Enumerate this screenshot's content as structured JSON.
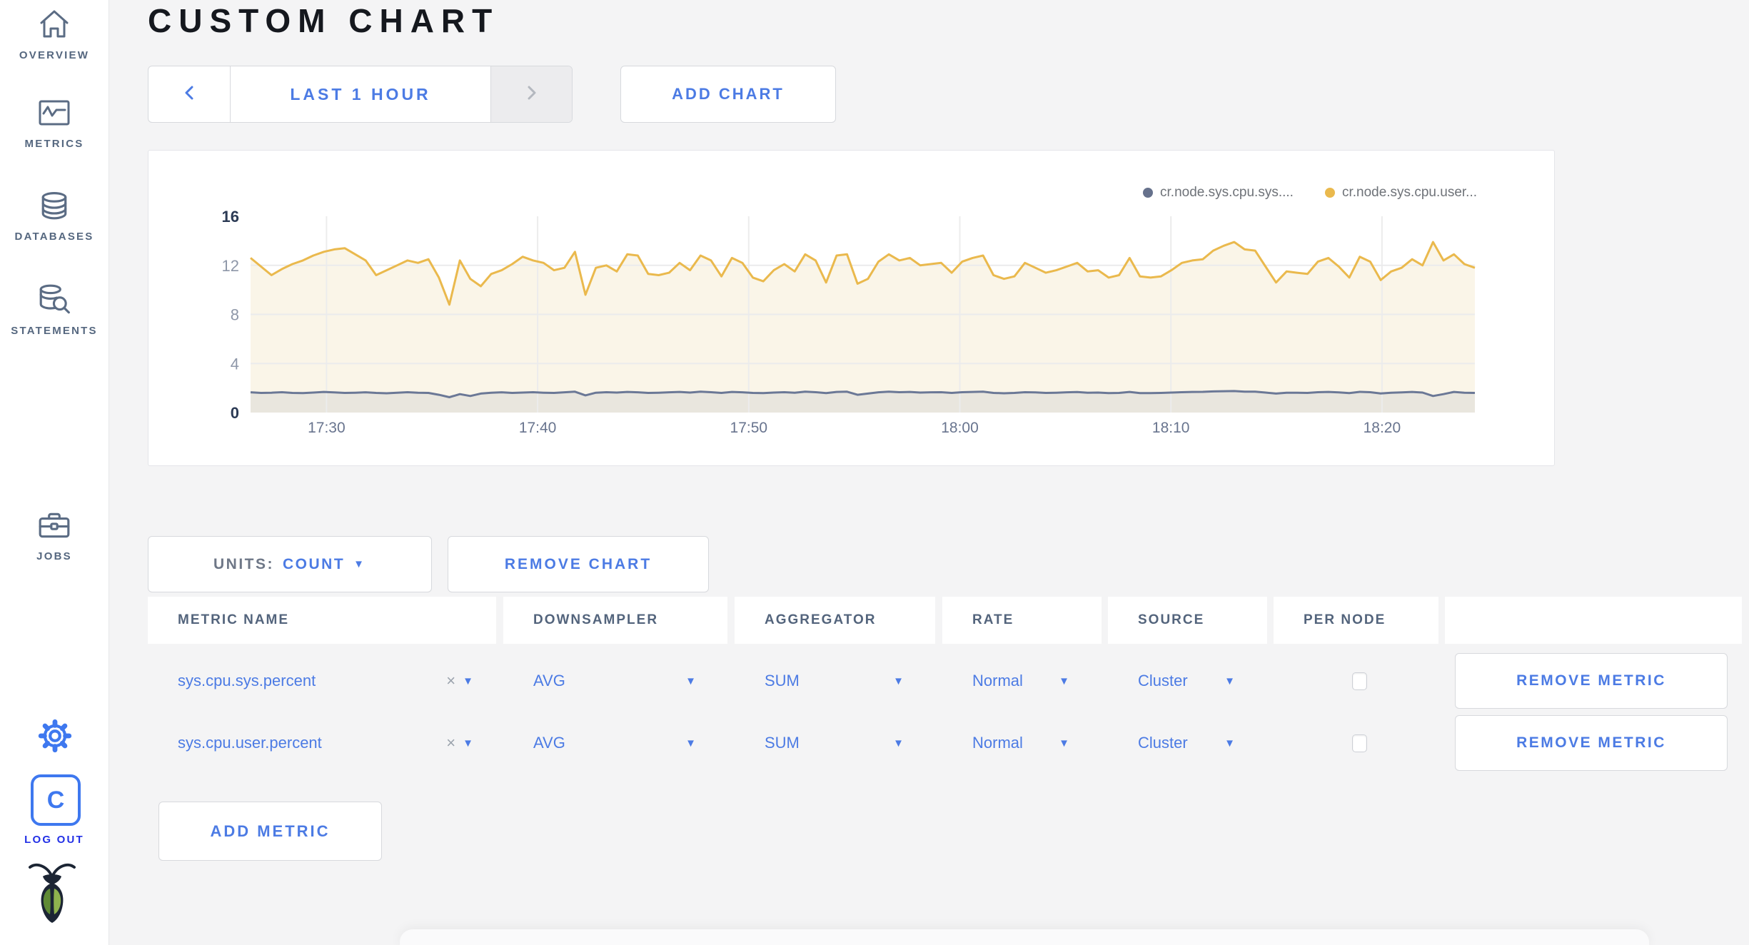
{
  "page": {
    "title": "CUSTOM CHART"
  },
  "colors": {
    "accent_blue": "#4c7be4",
    "logout_blue": "#2230e6",
    "sidebar_slate": "#55677f",
    "series_gray": "#66718c",
    "series_yellow": "#eab94d"
  },
  "sidebar": {
    "items": [
      {
        "label": "OVERVIEW",
        "icon": "home-icon"
      },
      {
        "label": "METRICS",
        "icon": "metrics-icon"
      },
      {
        "label": "DATABASES",
        "icon": "database-icon"
      },
      {
        "label": "STATEMENTS",
        "icon": "statements-icon"
      },
      {
        "label": "JOBS",
        "icon": "jobs-icon"
      }
    ],
    "logout_label": "LOG OUT"
  },
  "toolbar": {
    "time_range_label": "LAST 1 HOUR",
    "add_chart_label": "ADD CHART"
  },
  "chart_card": {
    "legend": [
      {
        "label": "cr.node.sys.cpu.sys....",
        "color": "#66718c"
      },
      {
        "label": "cr.node.sys.cpu.user...",
        "color": "#eab94d"
      }
    ]
  },
  "chart_data": {
    "type": "area",
    "title": "",
    "xlabel": "",
    "ylabel": "",
    "ylim": [
      0,
      16
    ],
    "x_domain_minutes": 58,
    "yticks": [
      {
        "v": 16,
        "strong": true,
        "grid": false
      },
      {
        "v": 12,
        "strong": false,
        "grid": true
      },
      {
        "v": 8,
        "strong": false,
        "grid": true
      },
      {
        "v": 4,
        "strong": false,
        "grid": true
      },
      {
        "v": 0,
        "strong": true,
        "grid": false
      }
    ],
    "xticks": [
      {
        "label": "17:30",
        "min": 3.6
      },
      {
        "label": "17:40",
        "min": 13.6
      },
      {
        "label": "17:50",
        "min": 23.6
      },
      {
        "label": "18:00",
        "min": 33.6
      },
      {
        "label": "18:10",
        "min": 43.6
      },
      {
        "label": "18:20",
        "min": 53.6
      }
    ],
    "series": [
      {
        "name": "cr.node.sys.cpu.sys....",
        "color": "#6b7896",
        "fill": "#e9e6de",
        "values": [
          1.65,
          1.6,
          1.62,
          1.66,
          1.6,
          1.58,
          1.63,
          1.68,
          1.64,
          1.6,
          1.62,
          1.65,
          1.6,
          1.57,
          1.62,
          1.66,
          1.62,
          1.6,
          1.45,
          1.25,
          1.5,
          1.35,
          1.55,
          1.62,
          1.65,
          1.6,
          1.63,
          1.66,
          1.62,
          1.6,
          1.65,
          1.7,
          1.4,
          1.62,
          1.66,
          1.63,
          1.68,
          1.65,
          1.6,
          1.62,
          1.65,
          1.68,
          1.63,
          1.7,
          1.66,
          1.6,
          1.68,
          1.65,
          1.6,
          1.58,
          1.63,
          1.66,
          1.62,
          1.7,
          1.66,
          1.58,
          1.68,
          1.7,
          1.45,
          1.55,
          1.65,
          1.7,
          1.66,
          1.68,
          1.63,
          1.65,
          1.66,
          1.6,
          1.66,
          1.68,
          1.7,
          1.6,
          1.57,
          1.6,
          1.66,
          1.64,
          1.6,
          1.62,
          1.65,
          1.67,
          1.62,
          1.63,
          1.58,
          1.6,
          1.68,
          1.59,
          1.58,
          1.6,
          1.63,
          1.66,
          1.68,
          1.69,
          1.72,
          1.74,
          1.75,
          1.7,
          1.7,
          1.63,
          1.55,
          1.62,
          1.61,
          1.6,
          1.66,
          1.68,
          1.64,
          1.58,
          1.69,
          1.66,
          1.56,
          1.62,
          1.64,
          1.68,
          1.63,
          1.35,
          1.5,
          1.68,
          1.62,
          1.6
        ]
      },
      {
        "name": "cr.node.sys.cpu.user...",
        "color": "#eab94d",
        "fill": "#faf5e8",
        "values": [
          12.6,
          11.9,
          11.2,
          11.7,
          12.1,
          12.4,
          12.8,
          13.1,
          13.3,
          13.4,
          12.9,
          12.4,
          11.2,
          11.6,
          12.0,
          12.4,
          12.2,
          12.5,
          11.0,
          8.8,
          12.4,
          10.9,
          10.3,
          11.3,
          11.6,
          12.1,
          12.7,
          12.4,
          12.2,
          11.6,
          11.8,
          13.1,
          9.6,
          11.8,
          12.0,
          11.5,
          12.9,
          12.8,
          11.3,
          11.2,
          11.4,
          12.2,
          11.6,
          12.8,
          12.4,
          11.1,
          12.6,
          12.2,
          11.0,
          10.7,
          11.6,
          12.1,
          11.5,
          12.9,
          12.4,
          10.6,
          12.8,
          12.9,
          10.5,
          10.9,
          12.3,
          12.9,
          12.4,
          12.6,
          12.0,
          12.1,
          12.2,
          11.4,
          12.3,
          12.6,
          12.8,
          11.2,
          10.9,
          11.1,
          12.2,
          11.8,
          11.4,
          11.6,
          11.9,
          12.2,
          11.5,
          11.6,
          11.0,
          11.2,
          12.6,
          11.1,
          11.0,
          11.1,
          11.6,
          12.2,
          12.4,
          12.5,
          13.2,
          13.6,
          13.9,
          13.3,
          13.2,
          11.9,
          10.6,
          11.5,
          11.4,
          11.3,
          12.3,
          12.6,
          11.9,
          11.0,
          12.7,
          12.3,
          10.8,
          11.5,
          11.8,
          12.5,
          12.0,
          13.9,
          12.4,
          12.9,
          12.1,
          11.8
        ]
      }
    ]
  },
  "controls": {
    "units_label": "UNITS:",
    "units_value": "COUNT",
    "remove_chart_label": "REMOVE CHART",
    "add_metric_label": "ADD METRIC"
  },
  "table": {
    "columns": [
      "METRIC NAME",
      "DOWNSAMPLER",
      "AGGREGATOR",
      "RATE",
      "SOURCE",
      "PER NODE"
    ],
    "rows": [
      {
        "metric": "sys.cpu.sys.percent",
        "downsampler": "AVG",
        "aggregator": "SUM",
        "rate": "Normal",
        "source": "Cluster",
        "per_node_checked": false,
        "remove_label": "REMOVE METRIC"
      },
      {
        "metric": "sys.cpu.user.percent",
        "downsampler": "AVG",
        "aggregator": "SUM",
        "rate": "Normal",
        "source": "Cluster",
        "per_node_checked": false,
        "remove_label": "REMOVE METRIC"
      }
    ]
  }
}
